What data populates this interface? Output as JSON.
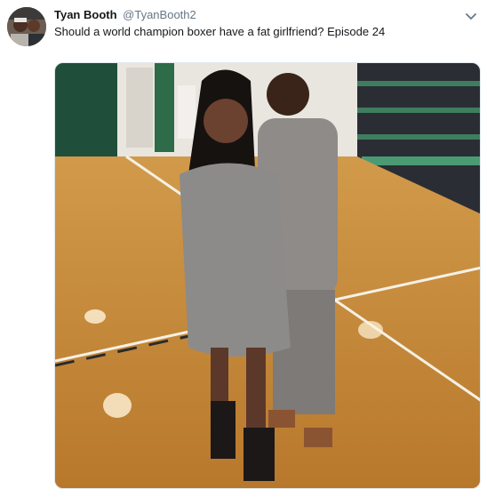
{
  "tweet": {
    "display_name": "Tyan Booth",
    "handle": "@TyanBooth2",
    "text": "Should a world champion boxer have a fat girlfriend? Episode 24"
  },
  "icons": {
    "avatar": "profile-avatar",
    "more": "chevron-down-icon"
  },
  "colors": {
    "name": "#14171a",
    "handle": "#657786",
    "border": "#e1e8ed"
  }
}
